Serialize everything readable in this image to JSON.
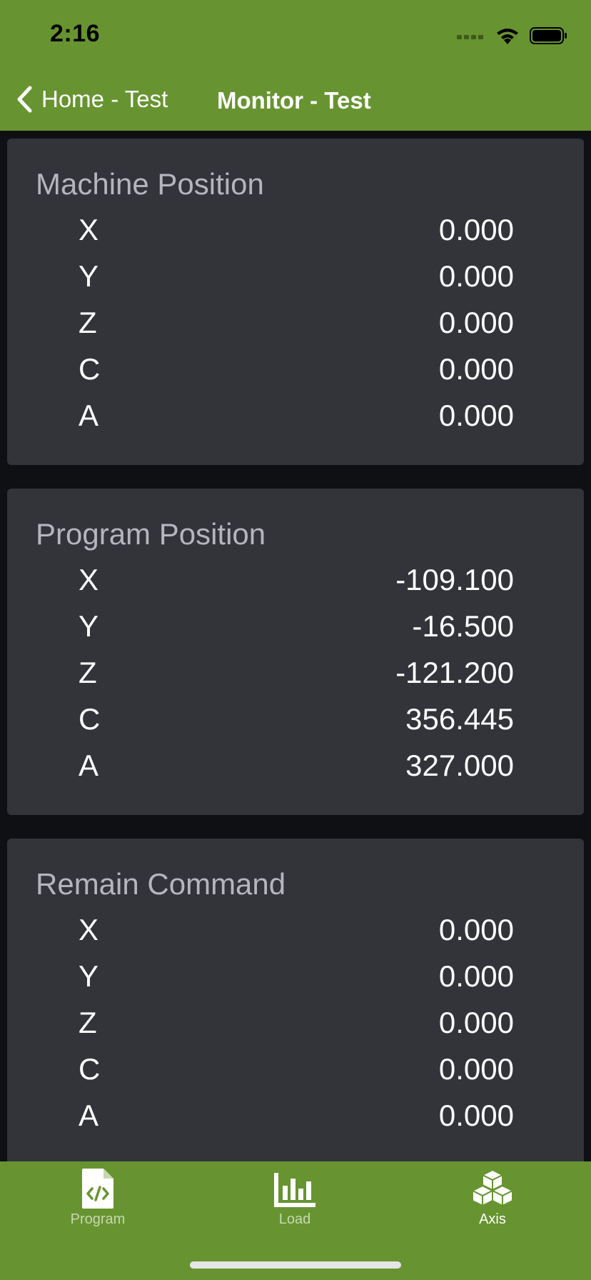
{
  "status_bar": {
    "time": "2:16"
  },
  "nav": {
    "back_label": "Home - Test",
    "title": "Monitor - Test"
  },
  "sections": [
    {
      "title": "Machine Position",
      "rows": [
        {
          "axis": "X",
          "value": "0.000"
        },
        {
          "axis": "Y",
          "value": "0.000"
        },
        {
          "axis": "Z",
          "value": "0.000"
        },
        {
          "axis": "C",
          "value": "0.000"
        },
        {
          "axis": "A",
          "value": "0.000"
        }
      ]
    },
    {
      "title": "Program Position",
      "rows": [
        {
          "axis": "X",
          "value": "-109.100"
        },
        {
          "axis": "Y",
          "value": "-16.500"
        },
        {
          "axis": "Z",
          "value": "-121.200"
        },
        {
          "axis": "C",
          "value": "356.445"
        },
        {
          "axis": "A",
          "value": "327.000"
        }
      ]
    },
    {
      "title": "Remain Command",
      "rows": [
        {
          "axis": "X",
          "value": "0.000"
        },
        {
          "axis": "Y",
          "value": "0.000"
        },
        {
          "axis": "Z",
          "value": "0.000"
        },
        {
          "axis": "C",
          "value": "0.000"
        },
        {
          "axis": "A",
          "value": "0.000"
        }
      ]
    }
  ],
  "tabs": [
    {
      "label": "Program",
      "icon": "code-file-icon",
      "active": false
    },
    {
      "label": "Load",
      "icon": "bar-chart-icon",
      "active": false
    },
    {
      "label": "Axis",
      "icon": "cubes-icon",
      "active": true
    }
  ],
  "colors": {
    "header_bg": "#679430",
    "card_bg": "#33343a",
    "page_bg": "#0f1014"
  }
}
